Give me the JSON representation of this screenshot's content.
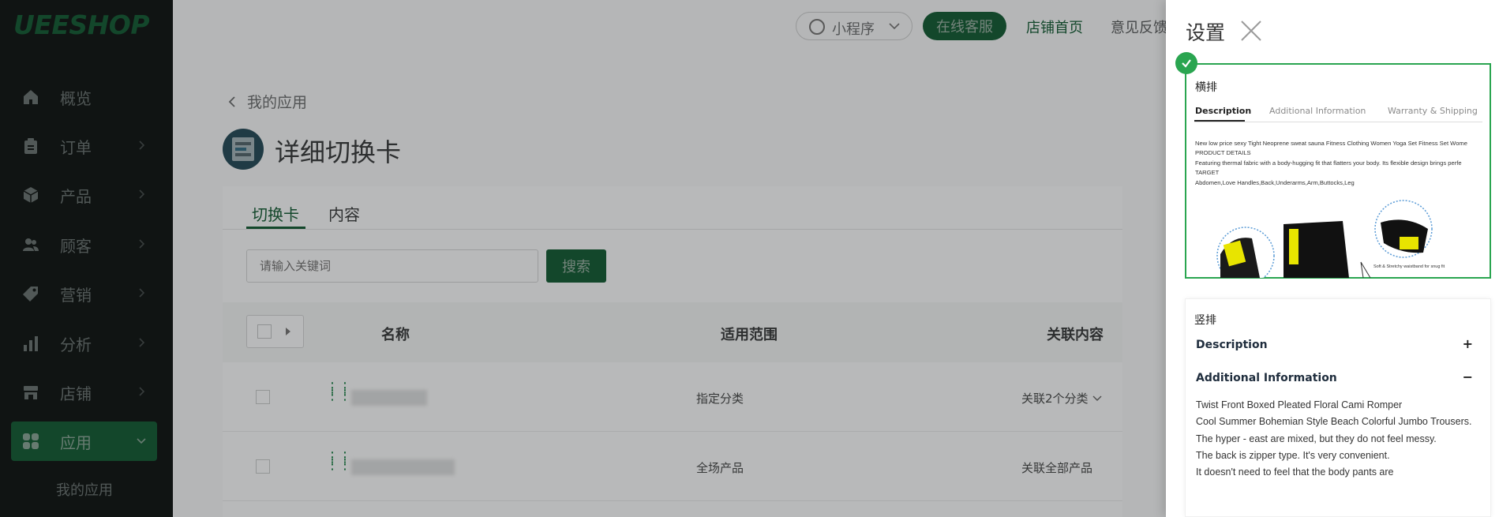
{
  "sidebar": {
    "logo": "UEESHOP",
    "items": [
      {
        "label": "概览",
        "icon": "home-icon",
        "has_chevron": false
      },
      {
        "label": "订单",
        "icon": "clipboard-icon",
        "has_chevron": true
      },
      {
        "label": "产品",
        "icon": "box-icon",
        "has_chevron": true
      },
      {
        "label": "顾客",
        "icon": "users-icon",
        "has_chevron": true
      },
      {
        "label": "营销",
        "icon": "tag-icon",
        "has_chevron": true
      },
      {
        "label": "分析",
        "icon": "bar-chart-icon",
        "has_chevron": true
      },
      {
        "label": "店铺",
        "icon": "store-icon",
        "has_chevron": true
      },
      {
        "label": "应用",
        "icon": "apps-icon",
        "has_chevron": true,
        "active": true
      }
    ],
    "subitem": "我的应用"
  },
  "topbar": {
    "mini_program": "小程序",
    "online_service": "在线客服",
    "store_home": "店铺首页",
    "feedback": "意见反馈"
  },
  "page": {
    "back_label": "我的应用",
    "title": "详细切换卡",
    "tabs": [
      "切换卡",
      "内容"
    ],
    "search_placeholder": "请输入关键词",
    "search_button": "搜索",
    "columns": [
      "名称",
      "适用范围",
      "关联内容"
    ],
    "rows": [
      {
        "scope": "指定分类",
        "relation": "关联2个分类"
      },
      {
        "scope": "全场产品",
        "relation": "关联全部产品"
      }
    ]
  },
  "drawer": {
    "title": "设置",
    "option_horizontal": {
      "label": "横排",
      "tabs": [
        "Description",
        "Additional Information",
        "Warranty & Shipping"
      ],
      "lines": [
        "New low price sexy Tight Neoprene sweat sauna Fitness Clothing Women Yoga Set Fitness Set Wome",
        "PRODUCT DETAILS",
        "Featuring thermal fabric with a body-hugging fit that flatters your body. Its flexible design brings perfe",
        "TARGET",
        " Abdomen,Love Handles,Back,Underarms,Arm,Buttocks,Leg"
      ],
      "image_caption": "Soft & Stretchy waistband for snug fit"
    },
    "option_vertical": {
      "label": "竖排",
      "sections": [
        {
          "title": "Description",
          "sign": "+"
        },
        {
          "title": "Additional Information",
          "sign": "−"
        }
      ],
      "body": [
        "Twist Front Boxed Pleated Floral Cami Romper",
        "Cool Summer Bohemian Style Beach Colorful Jumbo Trousers.",
        "The hyper - east  are mixed, but they do not feel messy.",
        "The back is zipper type. It's very convenient.",
        "It doesn't need to feel that the body pants are"
      ]
    }
  },
  "colors": {
    "brand_green": "#1a5f3a",
    "selected_border": "#2aa550",
    "sidebar_bg": "#161b1a"
  }
}
